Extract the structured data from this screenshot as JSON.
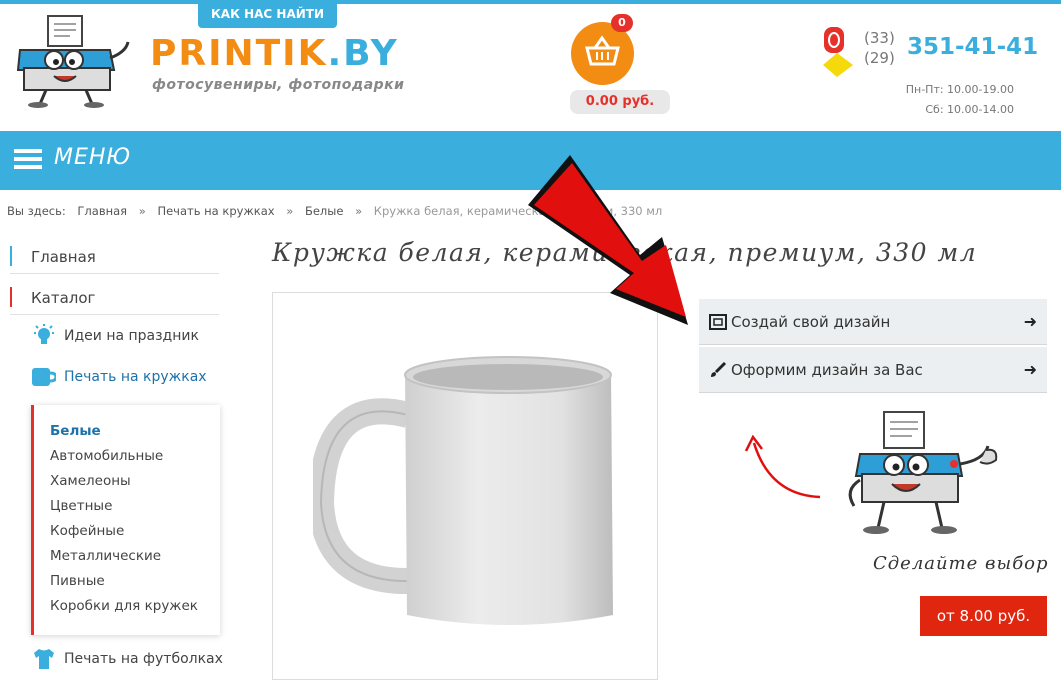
{
  "header": {
    "find_us": "КАК НАС НАЙТИ",
    "logo_main": "PRINTIK",
    "logo_tld": ".BY",
    "logo_tagline": "фотосувениры, фотоподарки",
    "cart_count": "0",
    "cart_total": "0.00 руб.",
    "phone_codes": [
      "(33)",
      "(29)"
    ],
    "phone_number": "351-41-41",
    "hours": [
      "Пн-Пт: 10.00-19.00",
      "Сб: 10.00-14.00"
    ]
  },
  "menu": {
    "label": "МЕНЮ"
  },
  "breadcrumb": {
    "prefix": "Вы здесь:",
    "items": [
      "Главная",
      "Печать на кружках",
      "Белые"
    ],
    "current": "Кружка белая, керамическая, премиум, 330 мл",
    "separator": "»"
  },
  "sidebar": {
    "home": "Главная",
    "catalog": "Каталог",
    "categories": [
      {
        "label": "Идеи на праздник",
        "icon": "lightbulb-icon"
      },
      {
        "label": "Печать на кружках",
        "icon": "mug-icon"
      },
      {
        "label": "Печать на футболках",
        "icon": "tshirt-icon"
      }
    ],
    "subcategories": [
      "Белые",
      "Автомобильные",
      "Хамелеоны",
      "Цветные",
      "Кофейные",
      "Металлические",
      "Пивные",
      "Коробки для кружек"
    ]
  },
  "product": {
    "title": "Кружка белая, керамическая, премиум, 330 мл",
    "actions": [
      {
        "label": "Создай свой дизайн",
        "icon": "design-frame-icon"
      },
      {
        "label": "Оформим дизайн за Вас",
        "icon": "brush-icon"
      }
    ],
    "choose_text": "Сделайте выбор",
    "price_button": "от 8.00 руб."
  },
  "colors": {
    "accent_blue": "#3aaedc",
    "orange": "#f28c13",
    "red": "#e0260f"
  }
}
